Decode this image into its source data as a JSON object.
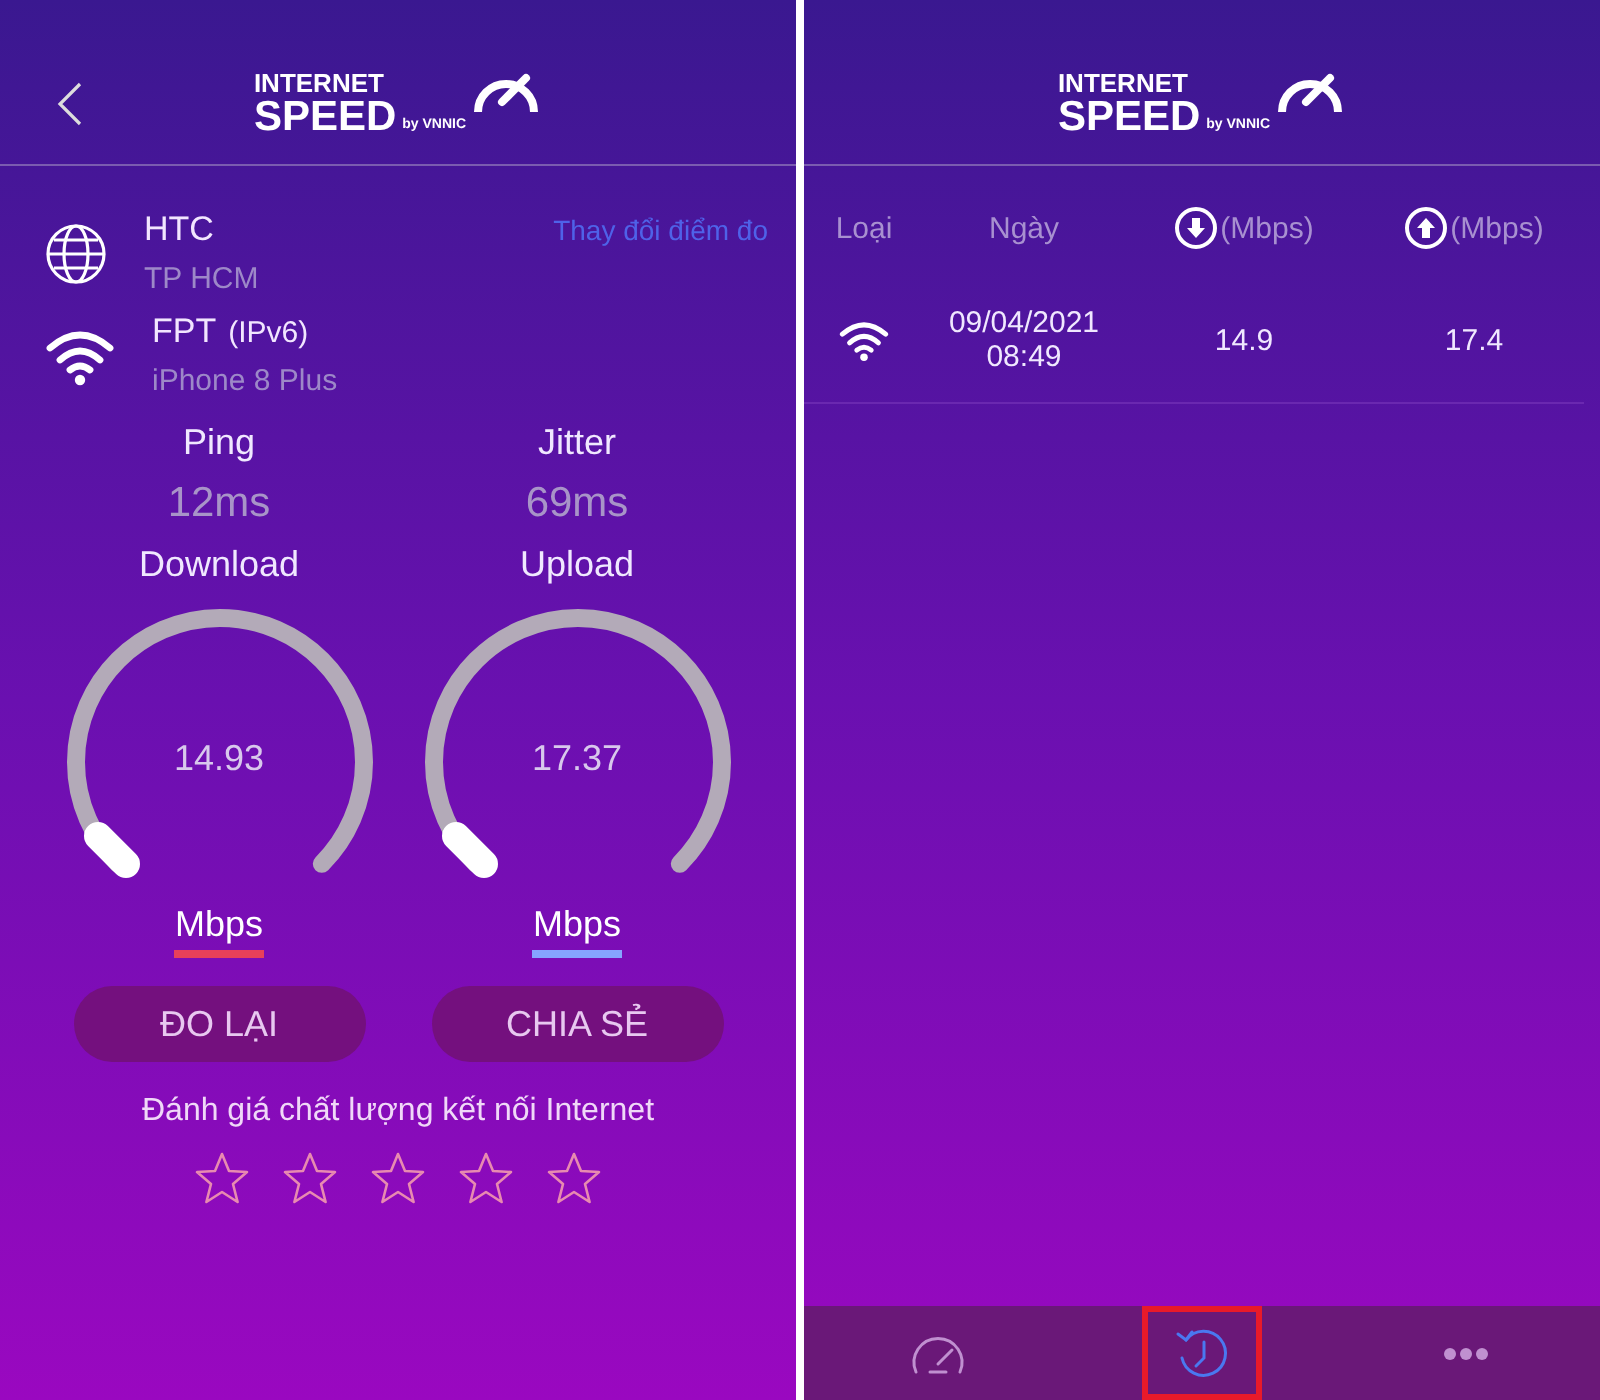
{
  "left_screen": {
    "logo": {
      "line_1": "INTERNET",
      "line_2": "SPEED",
      "byline": "by VNNIC"
    },
    "server": {
      "name": "HTC",
      "location": "TP HCM",
      "change_link": "Thay đổi điểm đo"
    },
    "network": {
      "provider": "FPT",
      "protocol": "(IPv6)",
      "device": "iPhone 8 Plus"
    },
    "stats": [
      {
        "label": "Ping",
        "value": "12ms"
      },
      {
        "label": "Jitter",
        "value": "69ms"
      }
    ],
    "gauges": [
      {
        "label": "Download",
        "value": "14.93",
        "unit": "Mbps",
        "color": "#e8405a"
      },
      {
        "label": "Upload",
        "value": "17.37",
        "unit": "Mbps",
        "color": "#86a4ff"
      }
    ],
    "buttons": [
      "ĐO LẠI",
      "CHIA SẺ"
    ],
    "rating": {
      "prompt": "Đánh giá chất lượng kết nối Internet",
      "stars": 0
    }
  },
  "right_screen": {
    "logo": {
      "line_1": "INTERNET",
      "line_2": "SPEED",
      "byline": "by VNNIC"
    },
    "table": {
      "columns": [
        {
          "kind": "text",
          "label": "Loại"
        },
        {
          "kind": "text",
          "label": "Ngày"
        },
        {
          "kind": "download",
          "label": "(Mbps)"
        },
        {
          "kind": "upload",
          "label": "(Mbps)"
        }
      ],
      "rows": [
        {
          "date": "09/04/2021",
          "time": "08:49",
          "download": "14.9",
          "upload": "17.4"
        }
      ]
    },
    "tab_bar": [
      {
        "kind": "speed",
        "selected": false,
        "highlighted": false
      },
      {
        "kind": "history",
        "selected": true,
        "highlighted": true
      },
      {
        "kind": "more",
        "selected": false,
        "highlighted": false
      }
    ]
  }
}
